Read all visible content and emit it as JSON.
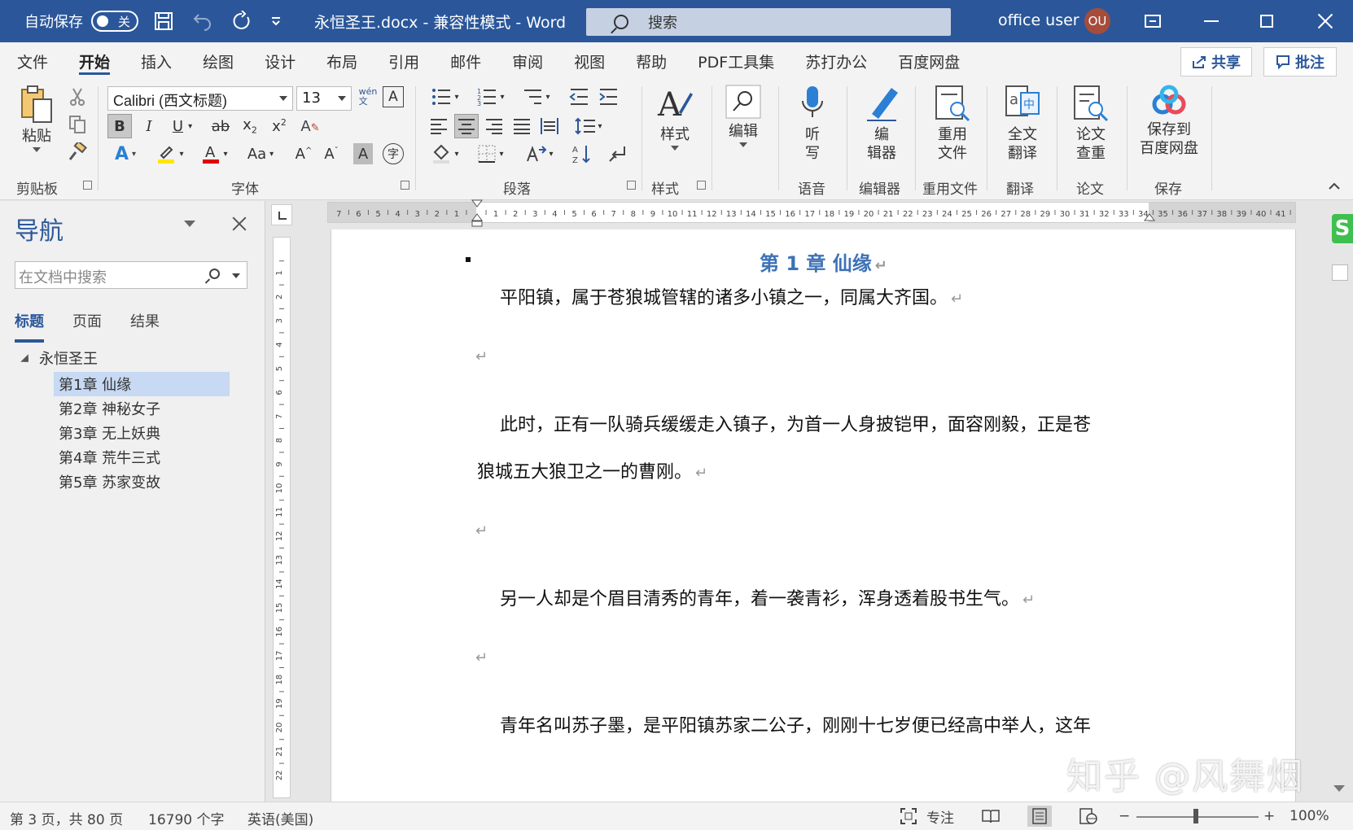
{
  "titlebar": {
    "autosave_label": "自动保存",
    "autosave_state": "关",
    "doc_title": "永恒圣王.docx  -  兼容性模式  -  Word",
    "search_label": "搜索",
    "user_name": "office user",
    "user_initials": "OU"
  },
  "tabs": [
    "文件",
    "开始",
    "插入",
    "绘图",
    "设计",
    "布局",
    "引用",
    "邮件",
    "审阅",
    "视图",
    "帮助",
    "PDF工具集",
    "苏打办公",
    "百度网盘"
  ],
  "share_label": "共享",
  "comment_label": "批注",
  "ribbon": {
    "clipboard": {
      "paste": "粘贴",
      "label": "剪贴板"
    },
    "font": {
      "name": "Calibri (西文标题)",
      "size": "13",
      "label": "字体"
    },
    "paragraph": {
      "label": "段落"
    },
    "styles": {
      "btn": "样式",
      "label": "样式"
    },
    "editing": {
      "btn": "编辑"
    },
    "voice": {
      "btn1": "听",
      "btn2": "写",
      "label": "语音"
    },
    "editor": {
      "btn1": "编",
      "btn2": "辑器",
      "label": "编辑器"
    },
    "reuse": {
      "btn1": "重用",
      "btn2": "文件",
      "label": "重用文件"
    },
    "translate": {
      "btn1": "全文",
      "btn2": "翻译",
      "label": "翻译"
    },
    "paper": {
      "btn1": "论文",
      "btn2": "查重",
      "label": "论文"
    },
    "save": {
      "btn1": "保存到",
      "btn2": "百度网盘",
      "label": "保存"
    }
  },
  "nav": {
    "title": "导航",
    "search_placeholder": "在文档中搜索",
    "tabs": [
      "标题",
      "页面",
      "结果"
    ],
    "root": "永恒圣王",
    "items": [
      "第1章 仙缘",
      "第2章 神秘女子",
      "第3章 无上妖典",
      "第4章 荒牛三式",
      "第5章 苏家变故"
    ]
  },
  "document": {
    "heading": "第 1 章  仙缘",
    "para1": "平阳镇，属于苍狼城管辖的诸多小镇之一，同属大齐国。",
    "para2a": "此时，正有一队骑兵缓缓走入镇子，为首一人身披铠甲，面容刚毅，正是苍",
    "para2b": "狼城五大狼卫之一的曹刚。",
    "para3": "另一人却是个眉目清秀的青年，着一袭青衫，浑身透着股书生气。",
    "para4": "青年名叫苏子墨，是平阳镇苏家二公子，刚刚十七岁便已经高中举人，这年",
    "para_mark": "↵"
  },
  "watermark": "知乎 @风舞烟",
  "status": {
    "page": "第 3 页，共 80 页",
    "words": "16790 个字",
    "language": "英语(美国)",
    "focus": "专注",
    "zoom": "100%"
  }
}
